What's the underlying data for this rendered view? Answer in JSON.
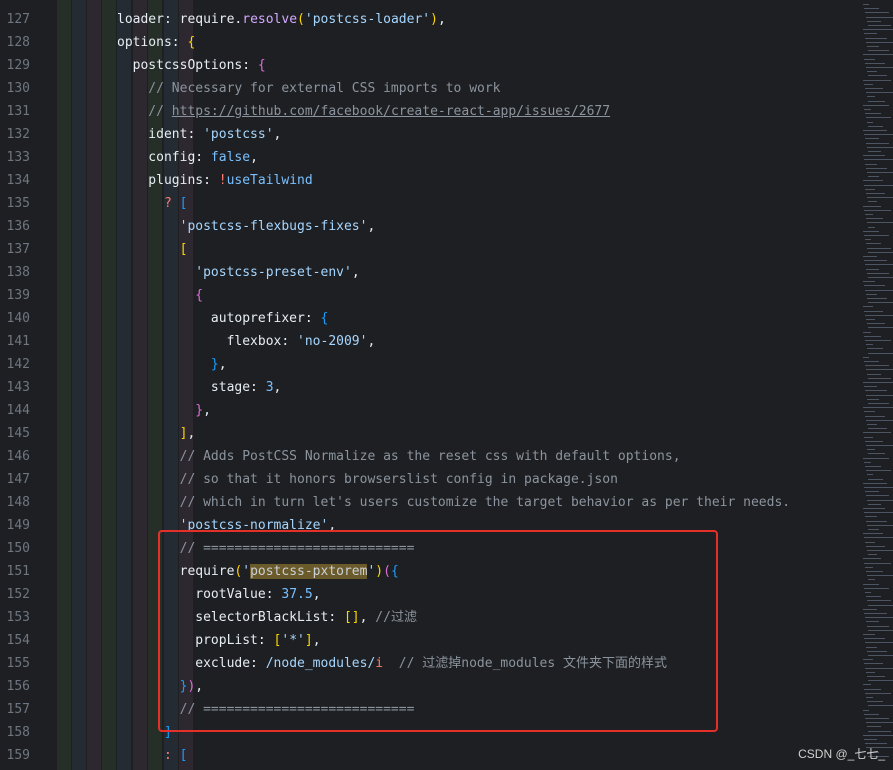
{
  "gutter": {
    "line_numbers": [
      "127",
      "128",
      "129",
      "130",
      "131",
      "132",
      "133",
      "134",
      "135",
      "136",
      "137",
      "138",
      "139",
      "140",
      "141",
      "142",
      "143",
      "144",
      "145",
      "146",
      "147",
      "148",
      "149",
      "150",
      "151",
      "152",
      "153",
      "154",
      "155",
      "156",
      "157",
      "158",
      "159"
    ]
  },
  "code": {
    "lines": [
      {
        "t": [
          [
            "prop",
            "loader: "
          ],
          [
            "prop",
            "require."
          ],
          [
            "fn",
            "resolve"
          ],
          [
            "br1",
            "("
          ],
          [
            "str",
            "'postcss-loader'"
          ],
          [
            "br1",
            ")"
          ],
          [
            "prop",
            ","
          ]
        ]
      },
      {
        "t": [
          [
            "prop",
            "options: "
          ],
          [
            "br1",
            "{"
          ]
        ]
      },
      {
        "t": [
          [
            "prop",
            "  postcssOptions: "
          ],
          [
            "br2",
            "{"
          ]
        ]
      },
      {
        "t": [
          [
            "c",
            "    // Necessary for external CSS imports to work"
          ]
        ]
      },
      {
        "t": [
          [
            "c",
            "    // "
          ],
          [
            "link",
            "https://github.com/facebook/create-react-app/issues/2677"
          ]
        ]
      },
      {
        "t": [
          [
            "prop",
            "    ident: "
          ],
          [
            "str",
            "'postcss'"
          ],
          [
            "prop",
            ","
          ]
        ]
      },
      {
        "t": [
          [
            "prop",
            "    config: "
          ],
          [
            "k",
            "false"
          ],
          [
            "prop",
            ","
          ]
        ]
      },
      {
        "t": [
          [
            "prop",
            "    plugins: "
          ],
          [
            "p",
            "!"
          ],
          [
            "k",
            "useTailwind"
          ]
        ]
      },
      {
        "t": [
          [
            "p",
            "      ? "
          ],
          [
            "br3",
            "["
          ]
        ]
      },
      {
        "t": [
          [
            "str",
            "        'postcss-flexbugs-fixes'"
          ],
          [
            "prop",
            ","
          ]
        ]
      },
      {
        "t": [
          [
            "br1",
            "        ["
          ]
        ]
      },
      {
        "t": [
          [
            "str",
            "          'postcss-preset-env'"
          ],
          [
            "prop",
            ","
          ]
        ]
      },
      {
        "t": [
          [
            "br2",
            "          {"
          ]
        ]
      },
      {
        "t": [
          [
            "prop",
            "            autoprefixer: "
          ],
          [
            "br3",
            "{"
          ]
        ]
      },
      {
        "t": [
          [
            "prop",
            "              flexbox: "
          ],
          [
            "str",
            "'no-2009'"
          ],
          [
            "prop",
            ","
          ]
        ]
      },
      {
        "t": [
          [
            "br3",
            "            }"
          ],
          [
            "prop",
            ","
          ]
        ]
      },
      {
        "t": [
          [
            "prop",
            "            stage: "
          ],
          [
            "num",
            "3"
          ],
          [
            "prop",
            ","
          ]
        ]
      },
      {
        "t": [
          [
            "br2",
            "          }"
          ],
          [
            "prop",
            ","
          ]
        ]
      },
      {
        "t": [
          [
            "br1",
            "        ]"
          ],
          [
            "prop",
            ","
          ]
        ]
      },
      {
        "t": [
          [
            "c",
            "        // Adds PostCSS Normalize as the reset css with default options,"
          ]
        ]
      },
      {
        "t": [
          [
            "c",
            "        // so that it honors browserslist config in package.json"
          ]
        ]
      },
      {
        "t": [
          [
            "c",
            "        // which in turn let's users customize the target behavior as per their needs."
          ]
        ]
      },
      {
        "t": [
          [
            "str",
            "        'postcss-normalize'"
          ],
          [
            "prop",
            ","
          ]
        ]
      },
      {
        "t": [
          [
            "c",
            "        // ==========================="
          ]
        ]
      },
      {
        "t": [
          [
            "prop",
            "        require"
          ],
          [
            "br1",
            "("
          ],
          [
            "str",
            "'"
          ],
          [
            "hl",
            "postcss-pxtorem"
          ],
          [
            "str",
            "'"
          ],
          [
            "br1",
            ")"
          ],
          [
            "br2",
            "("
          ],
          [
            "br3",
            "{"
          ]
        ]
      },
      {
        "t": [
          [
            "prop",
            "          rootValue: "
          ],
          [
            "num",
            "37.5"
          ],
          [
            "prop",
            ","
          ]
        ]
      },
      {
        "t": [
          [
            "prop",
            "          selectorBlackList: "
          ],
          [
            "br1",
            "[]"
          ],
          [
            "prop",
            ", "
          ],
          [
            "c",
            "//过滤"
          ]
        ]
      },
      {
        "t": [
          [
            "prop",
            "          propList: "
          ],
          [
            "br1",
            "["
          ],
          [
            "str",
            "'*'"
          ],
          [
            "br1",
            "]"
          ],
          [
            "prop",
            ","
          ]
        ]
      },
      {
        "t": [
          [
            "prop",
            "          exclude: "
          ],
          [
            "str",
            "/node_modules/"
          ],
          [
            "p",
            "i"
          ],
          [
            "prop",
            "  "
          ],
          [
            "c",
            "// 过滤掉node_modules 文件夹下面的样式"
          ]
        ]
      },
      {
        "t": [
          [
            "br3",
            "        }"
          ],
          [
            "br2",
            ")"
          ],
          [
            "prop",
            ","
          ]
        ]
      },
      {
        "t": [
          [
            "c",
            "        // ==========================="
          ]
        ]
      },
      {
        "t": [
          [
            "br3",
            "      ]"
          ]
        ]
      },
      {
        "t": [
          [
            "p",
            "      : "
          ],
          [
            "br3",
            "["
          ]
        ]
      }
    ]
  },
  "watermark": {
    "text": "CSDN @_七七_"
  },
  "colors": {
    "highlight_box": "#e5302a",
    "background": "#1e1f22"
  }
}
